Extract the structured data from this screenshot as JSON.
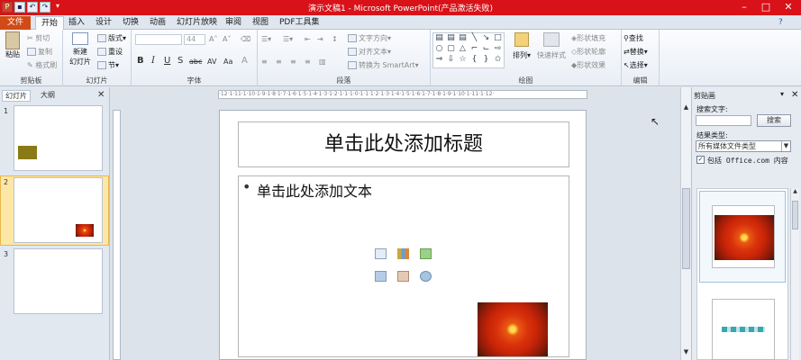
{
  "window": {
    "title": "演示文稿1 - Microsoft PowerPoint(产品激活失败)",
    "app_icon": "P",
    "colors": {
      "titlebar": "#d81218",
      "file_tab": "#d24a16",
      "accent": "#1f5fa8"
    }
  },
  "tabs": [
    "文件",
    "开始",
    "插入",
    "设计",
    "切换",
    "动画",
    "幻灯片放映",
    "审阅",
    "视图",
    "PDF工具集"
  ],
  "active_tab": "开始",
  "ribbon": {
    "clipboard": {
      "paste": "粘贴",
      "cut": "剪切",
      "copy": "复制",
      "format_painter": "格式刷",
      "label": "剪贴板"
    },
    "slides": {
      "new_slide_1": "新建",
      "new_slide_2": "幻灯片",
      "layout": "版式",
      "reset": "重设",
      "section": "节",
      "label": "幻灯片"
    },
    "font": {
      "size": "44",
      "label": "字体",
      "bold": "B",
      "italic": "I",
      "underline": "U",
      "shadow": "S",
      "strike": "abc",
      "spacing": "AV",
      "case": "Aa",
      "color": "A"
    },
    "paragraph": {
      "text_direction": "文字方向",
      "align_text": "对齐文本",
      "smartart": "转换为 SmartArt",
      "label": "段落"
    },
    "drawing": {
      "arrange": "排列",
      "quick_styles": "快速样式",
      "shape_fill": "形状填充",
      "shape_outline": "形状轮廓",
      "shape_effects": "形状效果",
      "label": "绘图"
    },
    "editing": {
      "find": "查找",
      "replace": "替换",
      "select": "选择",
      "label": "编辑"
    }
  },
  "left_pane": {
    "tabs": [
      "幻灯片",
      "大纲"
    ],
    "slides": [
      "1",
      "2",
      "3"
    ],
    "selected": "2"
  },
  "ruler_ticks": "·12·1·11·1·10·1·9·1·8·1·7·1·6·1·5·1·4·1·3·1·2·1·1·1·0·1·1·1·2·1·3·1·4·1·5·1·6·1·7·1·8·1·9·1·10·1·11·1·12·",
  "slide": {
    "title_placeholder": "单击此处添加标题",
    "body_placeholder": "单击此处添加文本",
    "bullet": "•"
  },
  "clip_pane": {
    "title": "剪贴画",
    "search_label": "搜索文字:",
    "search_value": "",
    "search_button": "搜索",
    "result_type_label": "结果类型:",
    "result_type_value": "所有媒体文件类型",
    "include_office": "包括 Office.com 内容",
    "include_checked": true
  }
}
